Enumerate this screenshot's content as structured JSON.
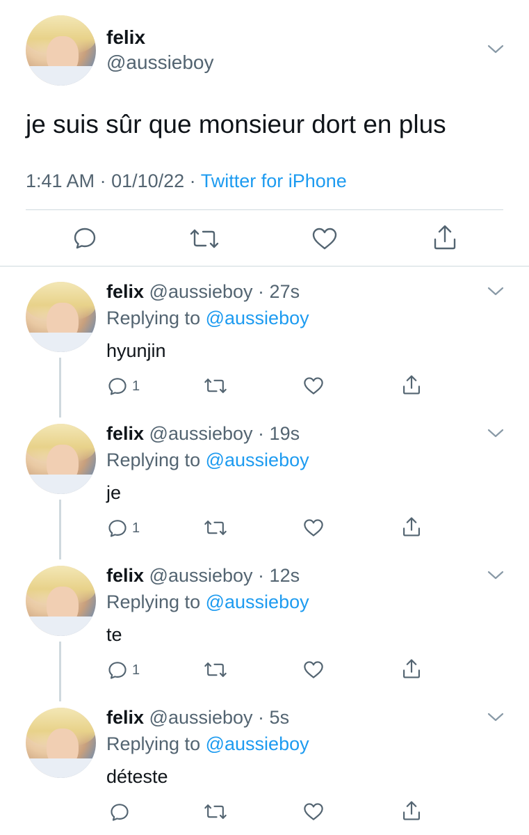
{
  "main_tweet": {
    "display_name": "felix",
    "handle": "@aussieboy",
    "text": "je suis sûr que monsieur dort en plus",
    "time": "1:41 AM",
    "date": "01/10/22",
    "source": "Twitter for iPhone",
    "actions": {
      "reply_icon": "reply-icon",
      "retweet_icon": "retweet-icon",
      "like_icon": "heart-icon",
      "share_icon": "share-icon"
    }
  },
  "replies": [
    {
      "display_name": "felix",
      "handle": "@aussieboy",
      "time": "27s",
      "replying_label": "Replying to",
      "replying_handle": "@aussieboy",
      "text": "hyunjin",
      "reply_count": "1"
    },
    {
      "display_name": "felix",
      "handle": "@aussieboy",
      "time": "19s",
      "replying_label": "Replying to",
      "replying_handle": "@aussieboy",
      "text": "je",
      "reply_count": "1"
    },
    {
      "display_name": "felix",
      "handle": "@aussieboy",
      "time": "12s",
      "replying_label": "Replying to",
      "replying_handle": "@aussieboy",
      "text": "te",
      "reply_count": "1"
    },
    {
      "display_name": "felix",
      "handle": "@aussieboy",
      "time": "5s",
      "replying_label": "Replying to",
      "replying_handle": "@aussieboy",
      "text": "déteste",
      "reply_count": ""
    }
  ],
  "colors": {
    "link": "#1d9bf0",
    "muted": "#536471",
    "divider": "#cfd9de"
  }
}
